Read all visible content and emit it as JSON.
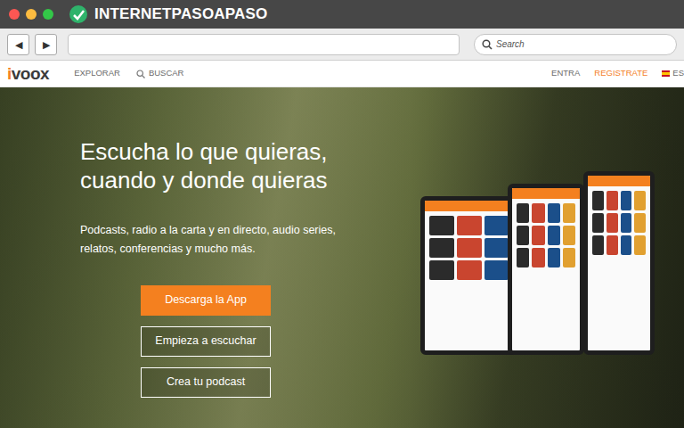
{
  "browser": {
    "logo": "INTERNETPASOAPASO",
    "back": "◀",
    "forward": "▶",
    "search": {
      "placeholder": "Search"
    }
  },
  "site_nav": {
    "logo": {
      "mark": "i",
      "rest": "voox"
    },
    "links": [
      {
        "label": "EXPLORAR",
        "kind": "plain"
      },
      {
        "label": "BUSCAR",
        "kind": "search"
      }
    ],
    "right": [
      {
        "label": "ENTRA",
        "color": "#6b6b6b"
      },
      {
        "label": "REGISTRATE",
        "color": "#f4801f"
      }
    ],
    "language": "ES"
  },
  "hero": {
    "title_lines": [
      "Escucha lo que quieras,",
      "cuando y donde quieras"
    ],
    "subtitle_lines": [
      "Podcasts, radio a la carta y en directo, audio series,",
      "relatos, conferencias y mucho más."
    ],
    "buttons": [
      {
        "label": "Descarga la App",
        "kind": "primary"
      },
      {
        "label": "Empieza a escuchar",
        "kind": "outline"
      },
      {
        "label": "Crea tu podcast",
        "kind": "outline"
      }
    ]
  }
}
